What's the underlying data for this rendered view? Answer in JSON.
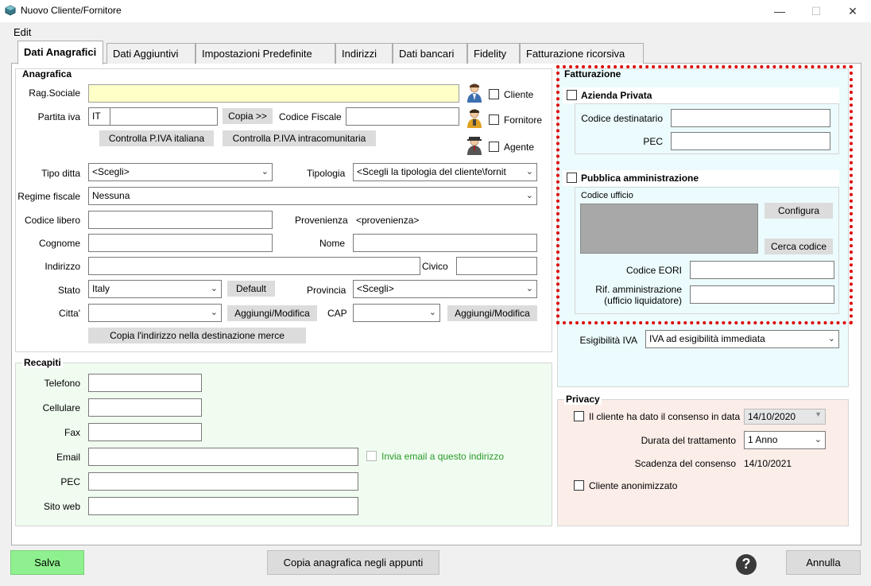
{
  "window": {
    "title": "Nuovo Cliente/Fornitore",
    "minimize": "—",
    "maximize": "☐",
    "close": "✕"
  },
  "menu": {
    "edit": "Edit"
  },
  "tabs": [
    "Dati Anagrafici",
    "Dati Aggiuntivi",
    "Impostazioni Predefinite",
    "Indirizzi",
    "Dati bancari",
    "Fidelity",
    "Fatturazione ricorsiva"
  ],
  "anagrafica": {
    "title": "Anagrafica",
    "rag_sociale_label": "Rag.Sociale",
    "partita_iva_label": "Partita iva",
    "partita_iva_prefix": "IT",
    "copia_btn": "Copia >>",
    "codice_fiscale_label": "Codice Fiscale",
    "controlla_it_btn": "Controlla P.IVA italiana",
    "controlla_intra_btn": "Controlla P.IVA intracomunitaria",
    "cliente_label": "Cliente",
    "fornitore_label": "Fornitore",
    "agente_label": "Agente",
    "tipo_ditta_label": "Tipo ditta",
    "tipo_ditta_value": "<Scegli>",
    "tipologia_label": "Tipologia",
    "tipologia_value": "<Scegli la tipologia del cliente\\fornit",
    "regime_label": "Regime fiscale",
    "regime_value": "Nessuna",
    "codice_libero_label": "Codice libero",
    "provenienza_label": "Provenienza",
    "provenienza_value": "<provenienza>",
    "cognome_label": "Cognome",
    "nome_label": "Nome",
    "indirizzo_label": "Indirizzo",
    "civico_label": "Civico",
    "stato_label": "Stato",
    "stato_value": "Italy",
    "default_btn": "Default",
    "provincia_label": "Provincia",
    "provincia_value": "<Scegli>",
    "citta_label": "Citta'",
    "aggiungi_btn": "Aggiungi/Modifica",
    "cap_label": "CAP",
    "aggiungi_cap_btn": "Aggiungi/Modifica",
    "copia_indirizzo_btn": "Copia l'indirizzo nella destinazione merce"
  },
  "recapiti": {
    "title": "Recapiti",
    "telefono": "Telefono",
    "cellulare": "Cellulare",
    "fax": "Fax",
    "email": "Email",
    "invia_email": "Invia email a questo indirizzo",
    "pec": "PEC",
    "sito_web": "Sito web"
  },
  "fatturazione": {
    "title": "Fatturazione",
    "azienda_privata": "Azienda Privata",
    "codice_destinatario": "Codice destinatario",
    "pec": "PEC",
    "pubblica_amministrazione": "Pubblica amministrazione",
    "codice_ufficio": "Codice ufficio",
    "configura_btn": "Configura",
    "cerca_codice_btn": "Cerca codice",
    "codice_eori": "Codice EORI",
    "rif_amm_line1": "Rif. amministrazione",
    "rif_amm_line2": "(ufficio liquidatore)",
    "esigibilita_label": "Esigibilità IVA",
    "esigibilita_value": "IVA ad esigibilità immediata"
  },
  "privacy": {
    "title": "Privacy",
    "consenso_label": "Il cliente ha dato il consenso in data",
    "consenso_date": "14/10/2020",
    "durata_label": "Durata del trattamento",
    "durata_value": "1 Anno",
    "scadenza_label": "Scadenza del consenso",
    "scadenza_value": "14/10/2021",
    "anonimizzato_label": "Cliente anonimizzato"
  },
  "footer": {
    "salva": "Salva",
    "copia_appunti": "Copia anagrafica negli appunti",
    "help": "?",
    "annulla": "Annulla"
  },
  "colors": {
    "salva_bg": "#8ef08e",
    "fatturazione_bg": "#ecfbfd",
    "privacy_bg": "#fbede8",
    "recapiti_bg": "#f0fcf0",
    "highlight_border": "#dd0000",
    "email_hint": "#2a9a2a"
  }
}
